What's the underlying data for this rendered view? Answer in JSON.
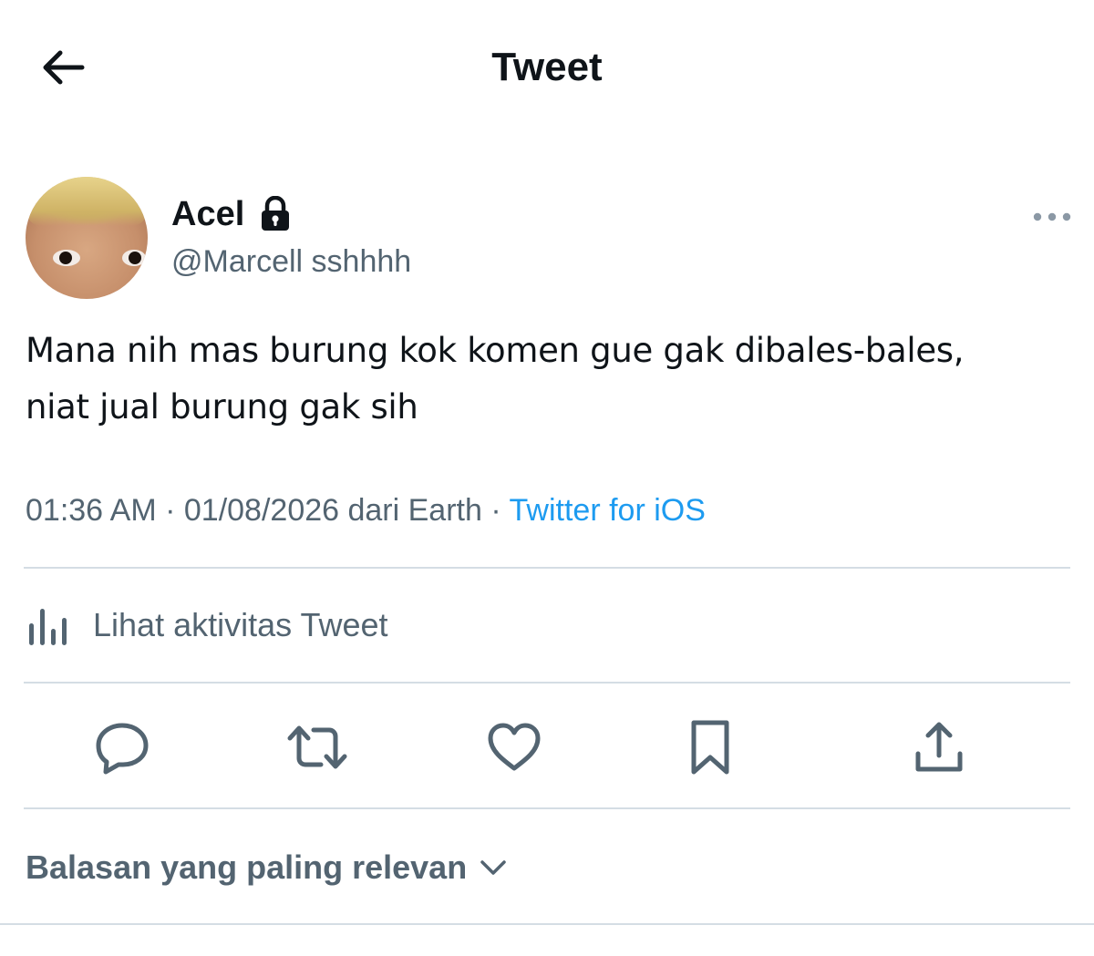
{
  "header": {
    "back_icon": "arrow-left-icon",
    "title": "Tweet"
  },
  "tweet": {
    "author": {
      "display_name": "Acel",
      "protected_icon": "lock-icon",
      "handle": "@Marcell sshhhh"
    },
    "more_icon": "more-horizontal-icon",
    "text_lines": [
      "Mana nih mas burung kok komen gue gak dibales-bales,",
      "niat jual burung gak sih"
    ],
    "meta": {
      "time": "01:36 AM",
      "separator": " · ",
      "date_location": "01/08/2026 dari Earth",
      "source": "Twitter for iOS"
    },
    "activity": {
      "icon": "analytics-bars-icon",
      "label": "Lihat aktivitas Tweet"
    },
    "actions": [
      {
        "name": "reply",
        "icon": "reply-icon"
      },
      {
        "name": "retweet",
        "icon": "retweet-icon"
      },
      {
        "name": "like",
        "icon": "heart-icon"
      },
      {
        "name": "bookmark",
        "icon": "bookmark-icon"
      },
      {
        "name": "share",
        "icon": "share-icon"
      }
    ]
  },
  "replies_sort": {
    "label": "Balasan yang paling relevan",
    "icon": "chevron-down-icon"
  },
  "colors": {
    "text_primary": "#0f1419",
    "text_secondary": "#536471",
    "link": "#1d9bf0",
    "divider": "#d4dde4"
  }
}
